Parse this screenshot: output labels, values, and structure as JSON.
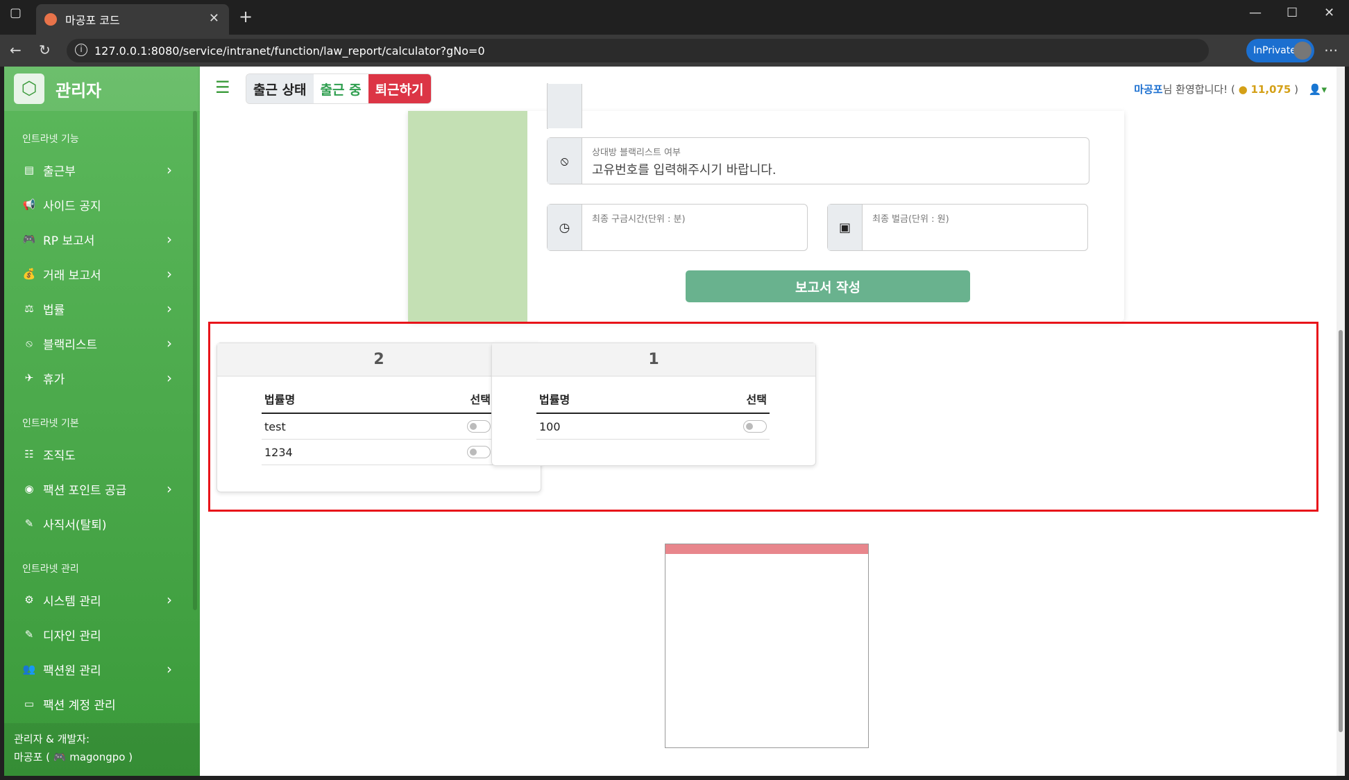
{
  "browser": {
    "tab_title": "마공포 코드",
    "url": "127.0.0.1:8080/service/intranet/function/law_report/calculator?gNo=0",
    "inprivate_label": "InPrivate"
  },
  "sidebar": {
    "brand": "관리자",
    "sections": [
      {
        "title": "인트라넷 기능",
        "items": [
          {
            "label": "출근부",
            "icon": "book-icon",
            "chevron": true
          },
          {
            "label": "사이드 공지",
            "icon": "megaphone-icon",
            "chevron": false
          },
          {
            "label": "RP 보고서",
            "icon": "gamepad-icon",
            "chevron": true
          },
          {
            "label": "거래 보고서",
            "icon": "money-bag-icon",
            "chevron": true
          },
          {
            "label": "법률",
            "icon": "scale-icon",
            "chevron": true
          },
          {
            "label": "블랙리스트",
            "icon": "ban-icon",
            "chevron": true
          },
          {
            "label": "휴가",
            "icon": "plane-icon",
            "chevron": true
          }
        ]
      },
      {
        "title": "인트라넷 기본",
        "items": [
          {
            "label": "조직도",
            "icon": "sitemap-icon",
            "chevron": false
          },
          {
            "label": "팩션 포인트 공급",
            "icon": "coins-icon",
            "chevron": true
          },
          {
            "label": "사직서(탈퇴)",
            "icon": "pen-icon",
            "chevron": false
          }
        ]
      },
      {
        "title": "인트라넷 관리",
        "items": [
          {
            "label": "시스템 관리",
            "icon": "gear-icon",
            "chevron": true
          },
          {
            "label": "디자인 관리",
            "icon": "brush-icon",
            "chevron": false
          },
          {
            "label": "팩션원 관리",
            "icon": "users-icon",
            "chevron": true
          },
          {
            "label": "팩션 계정 관리",
            "icon": "id-card-icon",
            "chevron": false
          }
        ]
      }
    ],
    "footer_line1": "관리자 & 개발자:",
    "footer_line2": "마공포 ( 🎮 magongpo )"
  },
  "topnav": {
    "status_label": "출근 상태",
    "status_value": "출근 중",
    "leave_button": "퇴근하기",
    "welcome_name": "마공포",
    "welcome_text": "님 환영합니다! (",
    "points": "11,075",
    "welcome_close": ")"
  },
  "form": {
    "blacklist_label": "상대방 블랙리스트 여부",
    "blacklist_value": "고유번호를 입력해주시기 바랍니다.",
    "detention_label": "최종 구금시간(단위 : 분)",
    "fine_label": "최종 벌금(단위 : 원)",
    "submit_button": "보고서 작성"
  },
  "law_cards": [
    {
      "title": "2",
      "col_name": "법률명",
      "col_select": "선택",
      "rows": [
        {
          "name": "test"
        },
        {
          "name": "1234"
        }
      ]
    },
    {
      "title": "1",
      "col_name": "법률명",
      "col_select": "선택",
      "rows": [
        {
          "name": "100"
        }
      ]
    }
  ],
  "colors": {
    "accent": "#5cb85c",
    "danger": "#dc3545",
    "highlight": "#e8141a"
  }
}
